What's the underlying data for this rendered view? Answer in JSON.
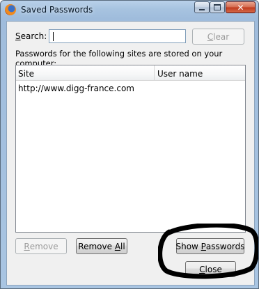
{
  "window": {
    "title": "Saved Passwords"
  },
  "search": {
    "label_mnemonic": "S",
    "label_rest": "earch:",
    "value": ""
  },
  "clear_button": {
    "mnemonic": "C",
    "rest": "lear"
  },
  "info_text": "Passwords for the following sites are stored on your computer:",
  "list": {
    "columns": [
      "Site",
      "User name"
    ],
    "rows": [
      {
        "site": "http://www.digg-france.com",
        "username": ""
      }
    ]
  },
  "buttons": {
    "remove": {
      "mnemonic": "R",
      "rest": "emove"
    },
    "remove_all": {
      "before": "Remove ",
      "mnemonic": "A",
      "rest": "ll"
    },
    "show_passwords": {
      "before": "Show ",
      "mnemonic": "P",
      "rest": "asswords"
    },
    "close": {
      "mnemonic": "C",
      "rest": "lose"
    }
  },
  "annotation": {
    "color": "#000000"
  }
}
